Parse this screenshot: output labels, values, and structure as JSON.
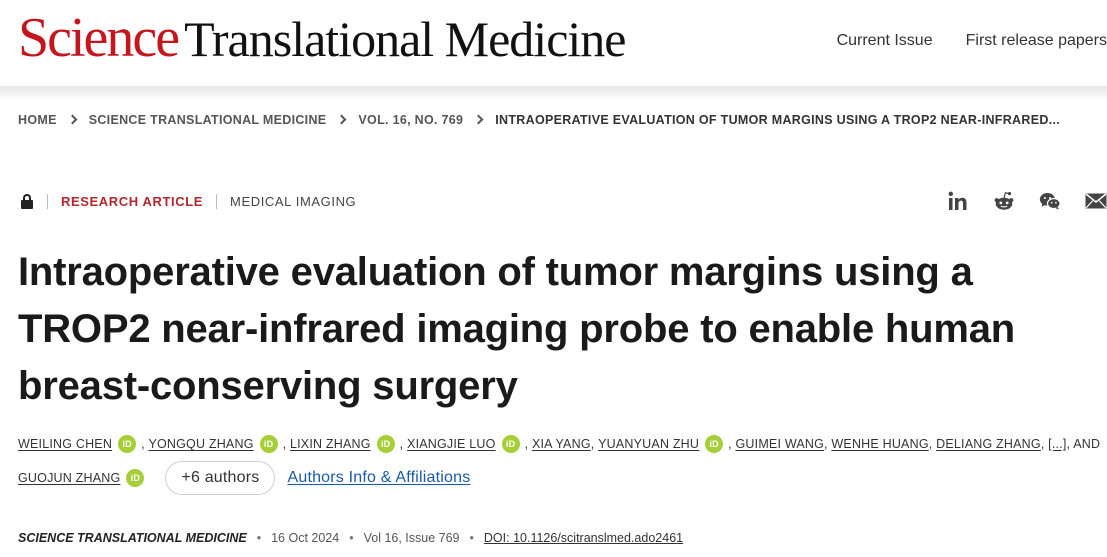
{
  "header": {
    "logo_science": "Science",
    "logo_rest": "Translational Medicine",
    "nav": [
      "Current Issue",
      "First release papers"
    ]
  },
  "breadcrumb": [
    "HOME",
    "SCIENCE TRANSLATIONAL MEDICINE",
    "VOL. 16, NO. 769",
    "INTRAOPERATIVE EVALUATION OF TUMOR MARGINS USING A TROP2 NEAR-INFRARED..."
  ],
  "article": {
    "access_icon": "lock-icon",
    "type": "RESEARCH ARTICLE",
    "subject": "MEDICAL IMAGING",
    "title": "Intraoperative evaluation of tumor margins using a TROP2 near-infrared imaging probe to enable human breast-conserving surgery"
  },
  "share": [
    "linkedin-icon",
    "reddit-icon",
    "wechat-icon",
    "email-icon"
  ],
  "authors": {
    "list": [
      "WEILING CHEN",
      "YONGQU ZHANG",
      "LIXIN ZHANG",
      "XIANGJIE LUO",
      "XIA YANG",
      "YUANYUAN ZHU",
      "GUIMEI WANG",
      "WENHE HUANG",
      "DELIANG ZHANG",
      "GUOJUN ZHANG"
    ],
    "ellipsis": "[...]",
    "and": ", AND",
    "orcid_badge": "iD",
    "more_button": "+6 authors",
    "affiliations_link": "Authors Info & Affiliations"
  },
  "citation": {
    "journal": "SCIENCE TRANSLATIONAL MEDICINE",
    "date": "16 Oct 2024",
    "volume_issue": "Vol 16, Issue 769",
    "doi": "DOI: 10.1126/scitranslmed.ado2461",
    "separator": "•"
  },
  "colors": {
    "brand_red": "#c4161c",
    "article_type": "#b1282e",
    "orcid_green": "#a6ce39",
    "link_blue": "#1a5aa6"
  }
}
